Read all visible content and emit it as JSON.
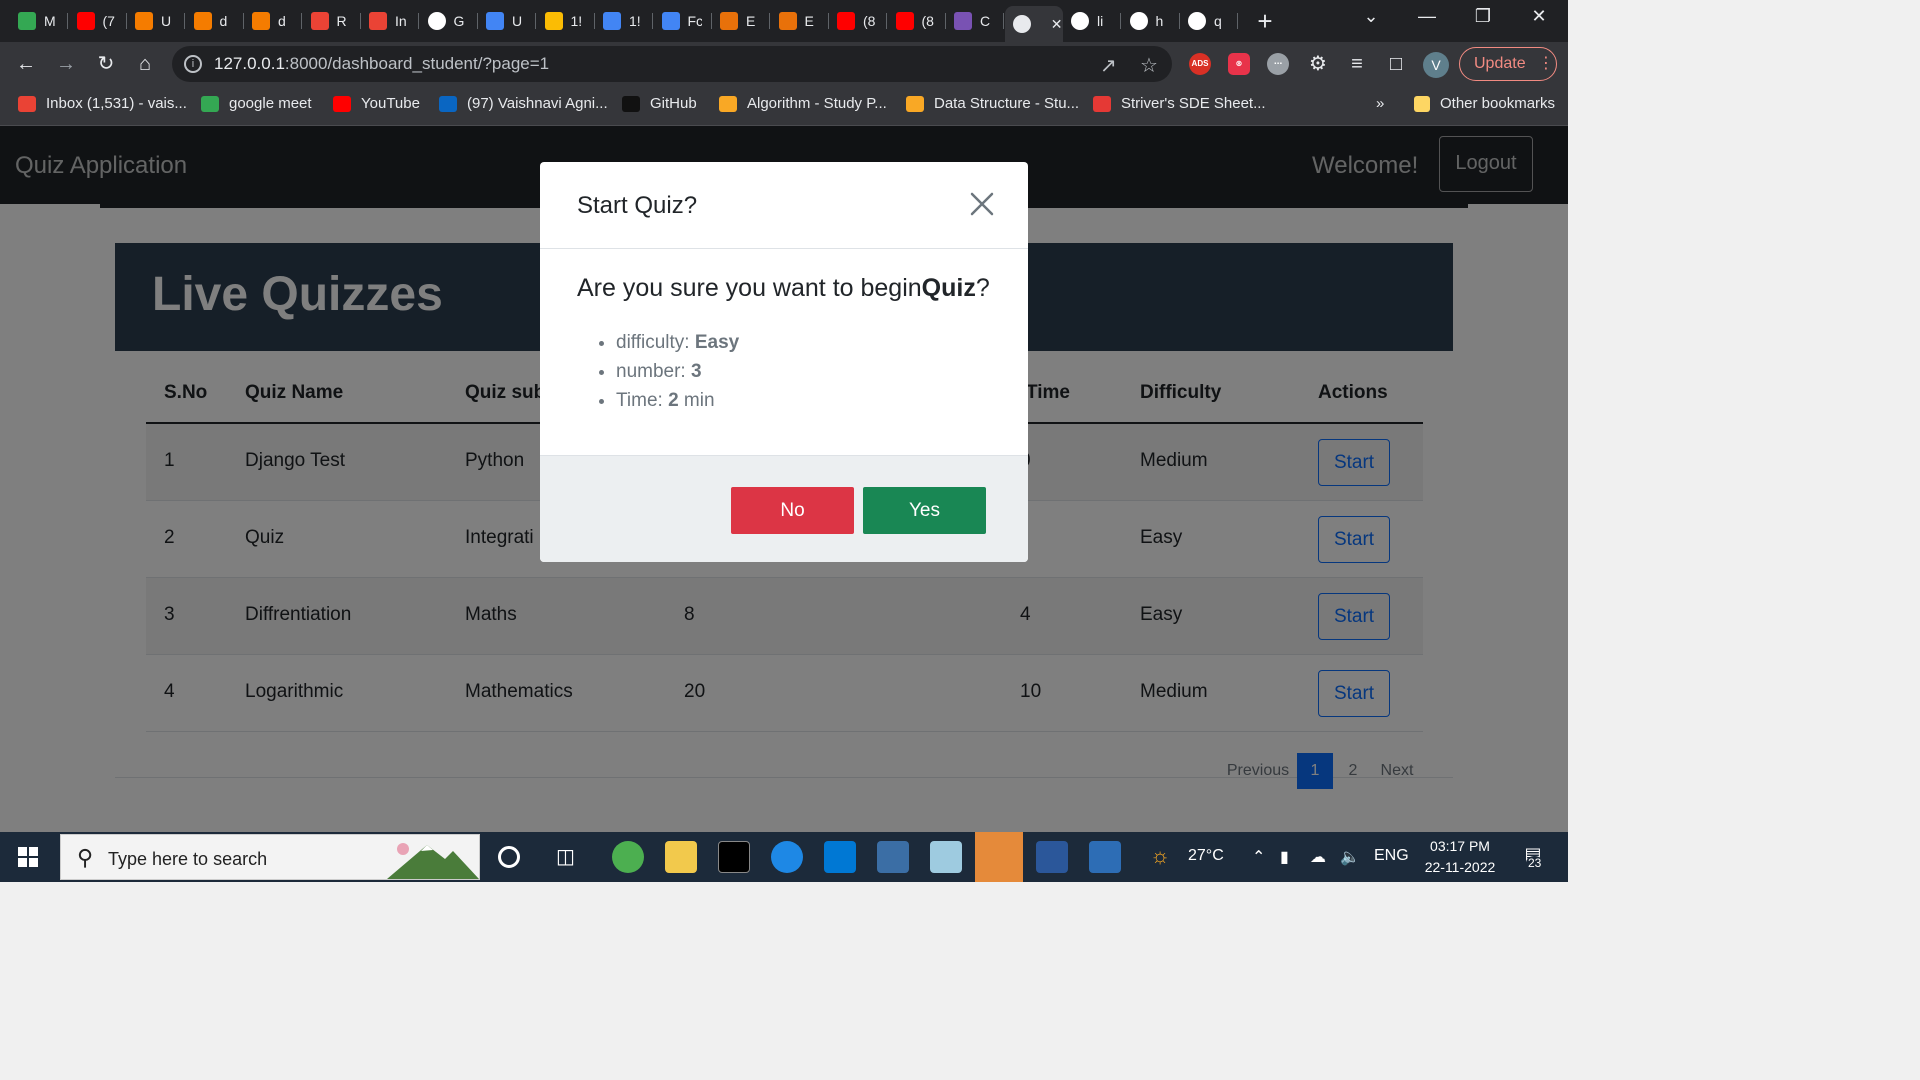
{
  "browser": {
    "tabs": [
      {
        "icon": "meet-icon",
        "label": "M",
        "color": "#34a853"
      },
      {
        "icon": "youtube-icon",
        "label": "(7",
        "color": "#ff0000"
      },
      {
        "icon": "algo-icon",
        "label": "U",
        "color": "#f57c00"
      },
      {
        "icon": "algo-icon",
        "label": "d",
        "color": "#f57c00"
      },
      {
        "icon": "algo-icon",
        "label": "d",
        "color": "#f57c00"
      },
      {
        "icon": "gmail-icon",
        "label": "R",
        "color": "#ea4335"
      },
      {
        "icon": "gmail-icon",
        "label": "In",
        "color": "#ea4335"
      },
      {
        "icon": "google-icon",
        "label": "G",
        "color": "#ffffff"
      },
      {
        "icon": "docs-icon",
        "label": "U",
        "color": "#4285f4"
      },
      {
        "icon": "drive-icon",
        "label": "1!",
        "color": "#fbbc04"
      },
      {
        "icon": "docs-icon",
        "label": "1!",
        "color": "#4285f4"
      },
      {
        "icon": "docs-icon",
        "label": "Fc",
        "color": "#4285f4"
      },
      {
        "icon": "ext-icon",
        "label": "E",
        "color": "#e8710a"
      },
      {
        "icon": "ext-icon",
        "label": "E",
        "color": "#e8710a"
      },
      {
        "icon": "youtube-icon",
        "label": "(8",
        "color": "#ff0000"
      },
      {
        "icon": "youtube-icon",
        "label": "(8",
        "color": "#ff0000"
      },
      {
        "icon": "bootstrap-icon",
        "label": "C",
        "color": "#7952b3"
      },
      {
        "icon": "globe-icon",
        "label": "",
        "color": "#e8eaed",
        "active": true
      },
      {
        "icon": "google-icon",
        "label": "li",
        "color": "#ffffff"
      },
      {
        "icon": "google-icon",
        "label": "h",
        "color": "#ffffff"
      },
      {
        "icon": "google-icon",
        "label": "q",
        "color": "#ffffff"
      }
    ],
    "url_host": "127.0.0.1",
    "url_path": ":8000/dashboard_student/?page=1",
    "avatar_letter": "V",
    "update_label": "Update",
    "bookmarks": [
      {
        "label": "Inbox (1,531) - vais...",
        "icon": "gmail-icon"
      },
      {
        "label": "google meet",
        "icon": "meet-icon"
      },
      {
        "label": "YouTube",
        "icon": "youtube-icon"
      },
      {
        "label": "(97) Vaishnavi Agni...",
        "icon": "linkedin-icon"
      },
      {
        "label": "GitHub",
        "icon": "github-icon"
      },
      {
        "label": "Algorithm - Study P...",
        "icon": "study-icon"
      },
      {
        "label": "Data Structure - Stu...",
        "icon": "study-icon"
      },
      {
        "label": "Striver's SDE Sheet...",
        "icon": "tuf-icon"
      }
    ],
    "bookmarks_overflow": "»",
    "other_bookmarks": "Other bookmarks"
  },
  "app": {
    "brand": "Quiz Application",
    "welcome": "Welcome!",
    "logout": "Logout",
    "hero_title": "Live Quizzes",
    "columns": [
      "S.No",
      "Quiz Name",
      "Quiz sub",
      "",
      "Time",
      "Difficulty",
      "Actions"
    ],
    "rows": [
      {
        "sno": "1",
        "name": "Django Test",
        "subject": "Python",
        "number": "",
        "time": "0",
        "difficulty": "Medium",
        "action": "Start"
      },
      {
        "sno": "2",
        "name": "Quiz",
        "subject": "Integrati",
        "number": "",
        "time": "",
        "difficulty": "Easy",
        "action": "Start"
      },
      {
        "sno": "3",
        "name": "Diffrentiation",
        "subject": "Maths",
        "number": "8",
        "time": "4",
        "difficulty": "Easy",
        "action": "Start"
      },
      {
        "sno": "4",
        "name": "Logarithmic",
        "subject": "Mathematics",
        "number": "20",
        "time": "10",
        "difficulty": "Medium",
        "action": "Start"
      }
    ],
    "pagination": {
      "previous": "Previous",
      "pages": [
        "1",
        "2"
      ],
      "current": "1",
      "next": "Next"
    }
  },
  "modal": {
    "title": "Start Quiz?",
    "question_prefix": "Are you sure you want to begin",
    "quiz_name": "Quiz",
    "question_suffix": "?",
    "details": [
      {
        "label": "difficulty: ",
        "value": "Easy",
        "suffix": ""
      },
      {
        "label": "number: ",
        "value": "3",
        "suffix": ""
      },
      {
        "label": "Time: ",
        "value": "2",
        "suffix": " min"
      }
    ],
    "no_label": "No",
    "yes_label": "Yes",
    "colors": {
      "no": "#dc3545",
      "yes": "#198754"
    }
  },
  "taskbar": {
    "search_placeholder": "Type here to search",
    "weather": "27°C",
    "language": "ENG",
    "time": "03:17 PM",
    "date": "22-11-2022",
    "notifications": "23"
  }
}
